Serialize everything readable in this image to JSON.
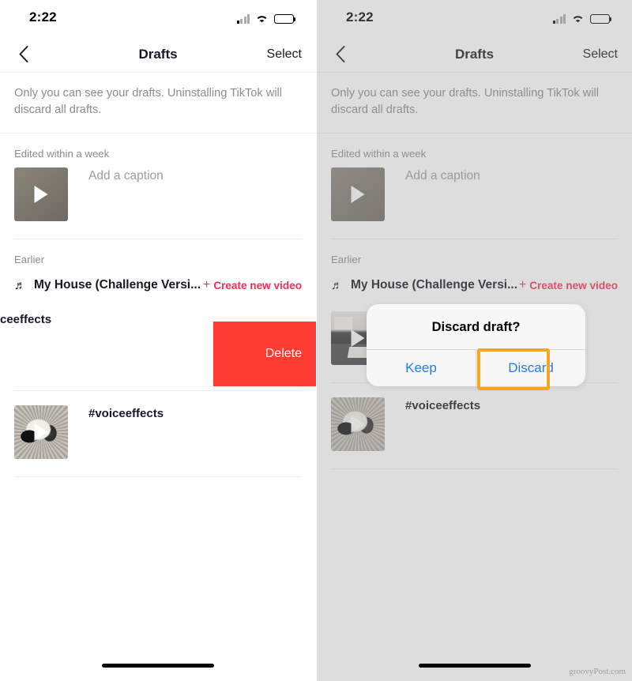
{
  "status_bar": {
    "time": "2:22",
    "signal_icon": "cellular-signal-icon",
    "wifi_icon": "wifi-icon",
    "battery_icon": "battery-icon"
  },
  "nav": {
    "back_icon": "chevron-left-icon",
    "title": "Drafts",
    "select_label": "Select"
  },
  "notice": "Only you can see your drafts. Uninstalling TikTok will discard all drafts.",
  "sections": [
    {
      "heading": "Edited within a week"
    },
    {
      "heading": "Earlier"
    }
  ],
  "recent_draft": {
    "caption": "Add a caption",
    "thumbnail": "video-thumbnail-gray",
    "play_icon": "play-icon"
  },
  "music_row": {
    "note_icon": "music-note-icon",
    "title": "My House (Challenge Versi...",
    "create_plus": "+",
    "create_label": "Create new video"
  },
  "swiped_draft": {
    "caption_visible": "ceeffects",
    "full_caption": "#voiceeffects",
    "delete_label": "Delete",
    "delete_color": "#FE3B30"
  },
  "second_draft": {
    "caption": "#voiceeffects",
    "thumbnail": "cat-photo-thumbnail",
    "play_icon": "play-icon"
  },
  "dialog": {
    "title": "Discard draft?",
    "keep_label": "Keep",
    "discard_label": "Discard",
    "button_color": "#1A7DFA",
    "highlight_color": "#F5A623"
  },
  "right_panel_draft": {
    "thumbnail": "desk-photo-thumbnail",
    "play_icon": "play-icon"
  },
  "colors": {
    "accent_red": "#FE2C55",
    "delete_red": "#FE3B30",
    "link_blue": "#1A7DFA",
    "highlight_amber": "#F5A623",
    "muted_text": "#8B8B90",
    "dark_text": "#161823"
  },
  "watermark": "groovyPost.com",
  "home_indicator": "home-indicator-bar"
}
